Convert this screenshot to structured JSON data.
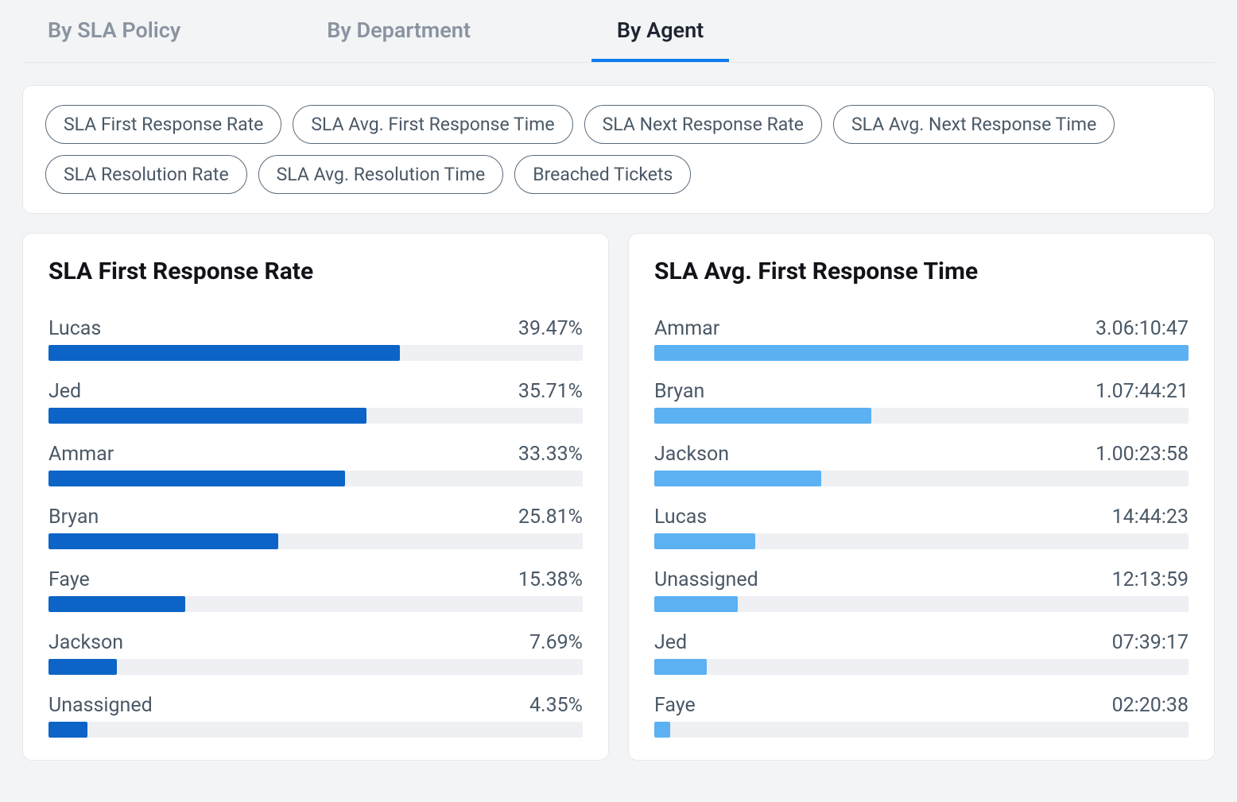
{
  "tabs": [
    {
      "label": "By SLA Policy",
      "active": false
    },
    {
      "label": "By Department",
      "active": false
    },
    {
      "label": "By Agent",
      "active": true
    }
  ],
  "chips": [
    "SLA First Response Rate",
    "SLA Avg. First Response Time",
    "SLA Next Response Rate",
    "SLA Avg. Next Response Time",
    "SLA Resolution Rate",
    "SLA Avg. Resolution Time",
    "Breached Tickets"
  ],
  "chart_data": [
    {
      "type": "bar",
      "title": "SLA First Response Rate",
      "unit": "percent",
      "max": 60,
      "series": [
        {
          "name": "Lucas",
          "value": 39.47,
          "display": "39.47%"
        },
        {
          "name": "Jed",
          "value": 35.71,
          "display": "35.71%"
        },
        {
          "name": "Ammar",
          "value": 33.33,
          "display": "33.33%"
        },
        {
          "name": "Bryan",
          "value": 25.81,
          "display": "25.81%"
        },
        {
          "name": "Faye",
          "value": 15.38,
          "display": "15.38%"
        },
        {
          "name": "Jackson",
          "value": 7.69,
          "display": "7.69%"
        },
        {
          "name": "Unassigned",
          "value": 4.35,
          "display": "4.35%"
        }
      ],
      "color": "dark"
    },
    {
      "type": "bar",
      "title": "SLA Avg. First Response Time",
      "unit": "duration_seconds",
      "max": 281447,
      "series": [
        {
          "name": "Ammar",
          "value": 281447,
          "display": "3.06:10:47"
        },
        {
          "name": "Bryan",
          "value": 114261,
          "display": "1.07:44:21"
        },
        {
          "name": "Jackson",
          "value": 87838,
          "display": "1.00:23:58"
        },
        {
          "name": "Lucas",
          "value": 53063,
          "display": "14:44:23"
        },
        {
          "name": "Unassigned",
          "value": 44039,
          "display": "12:13:59"
        },
        {
          "name": "Jed",
          "value": 27557,
          "display": "07:39:17"
        },
        {
          "name": "Faye",
          "value": 8438,
          "display": "02:20:38"
        }
      ],
      "color": "light"
    }
  ]
}
